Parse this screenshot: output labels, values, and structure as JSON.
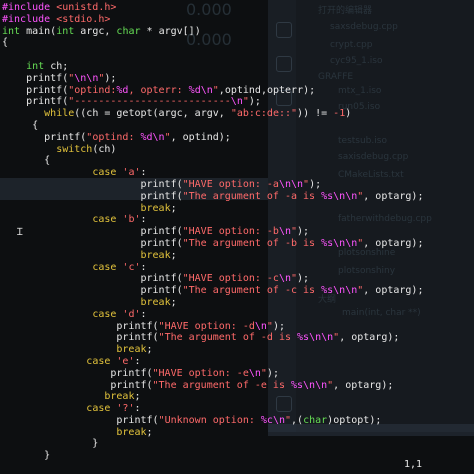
{
  "status": {
    "position": "1,1"
  },
  "lines": [
    [
      [
        "pp",
        "#include "
      ],
      [
        "inc",
        "<unistd.h>"
      ]
    ],
    [
      [
        "pp",
        "#include "
      ],
      [
        "inc",
        "<stdio.h>"
      ]
    ],
    [
      [
        "ty",
        "int "
      ],
      [
        "fn",
        "main("
      ],
      [
        "ty",
        "int "
      ],
      [
        "id",
        "argc, "
      ],
      [
        "ty",
        "char "
      ],
      [
        "id",
        "* argv[])"
      ]
    ],
    [
      [
        "id",
        "{"
      ]
    ],
    [
      [
        "id",
        ""
      ]
    ],
    [
      [
        "id",
        "    "
      ],
      [
        "ty",
        "int "
      ],
      [
        "id",
        "ch;"
      ]
    ],
    [
      [
        "id",
        "    printf("
      ],
      [
        "str",
        "\""
      ],
      [
        "esc",
        "\\n\\n"
      ],
      [
        "str",
        "\""
      ],
      [
        "id",
        ");"
      ]
    ],
    [
      [
        "id",
        "    printf("
      ],
      [
        "str",
        "\"optind:"
      ],
      [
        "esc",
        "%d"
      ],
      [
        "str",
        ", opterr: "
      ],
      [
        "esc",
        "%d\\n"
      ],
      [
        "str",
        "\""
      ],
      [
        "id",
        ",optind,opterr);"
      ]
    ],
    [
      [
        "id",
        "    printf("
      ],
      [
        "str",
        "\"--------------------------"
      ],
      [
        "esc",
        "\\n"
      ],
      [
        "str",
        "\""
      ],
      [
        "id",
        ");"
      ]
    ],
    [
      [
        "id",
        "       "
      ],
      [
        "kw",
        "while"
      ],
      [
        "id",
        "((ch = getopt(argc, argv, "
      ],
      [
        "str",
        "\"ab:c:de::\""
      ],
      [
        "id",
        ")) != "
      ],
      [
        "str",
        "-1"
      ],
      [
        "id",
        ")"
      ]
    ],
    [
      [
        "id",
        "     {"
      ]
    ],
    [
      [
        "id",
        "       printf("
      ],
      [
        "str",
        "\"optind: "
      ],
      [
        "esc",
        "%d\\n"
      ],
      [
        "str",
        "\""
      ],
      [
        "id",
        ", optind);"
      ]
    ],
    [
      [
        "id",
        "         "
      ],
      [
        "kw",
        "switch"
      ],
      [
        "id",
        "(ch)"
      ]
    ],
    [
      [
        "id",
        "       {"
      ]
    ],
    [
      [
        "id",
        "               "
      ],
      [
        "kw",
        "case "
      ],
      [
        "str",
        "'a'"
      ],
      [
        "id",
        ":"
      ]
    ],
    [
      [
        "id",
        "                       printf("
      ],
      [
        "str",
        "\"HAVE option: -a"
      ],
      [
        "esc",
        "\\n\\n"
      ],
      [
        "str",
        "\""
      ],
      [
        "id",
        ");"
      ]
    ],
    [
      [
        "id",
        "                       printf("
      ],
      [
        "str",
        "\"The argument of -a is "
      ],
      [
        "esc",
        "%s\\n\\n"
      ],
      [
        "str",
        "\""
      ],
      [
        "id",
        ", optarg);"
      ]
    ],
    [
      [
        "id",
        "                       "
      ],
      [
        "kw",
        "break"
      ],
      [
        "id",
        ";"
      ]
    ],
    [
      [
        "id",
        "               "
      ],
      [
        "kw",
        "case "
      ],
      [
        "str",
        "'b'"
      ],
      [
        "id",
        ":"
      ]
    ],
    [
      [
        "id",
        "                       printf("
      ],
      [
        "str",
        "\"HAVE option: -b"
      ],
      [
        "esc",
        "\\n"
      ],
      [
        "str",
        "\""
      ],
      [
        "id",
        ");"
      ]
    ],
    [
      [
        "id",
        "                       printf("
      ],
      [
        "str",
        "\"The argument of -b is "
      ],
      [
        "esc",
        "%s\\n\\n"
      ],
      [
        "str",
        "\""
      ],
      [
        "id",
        ", optarg);"
      ]
    ],
    [
      [
        "id",
        "                       "
      ],
      [
        "kw",
        "break"
      ],
      [
        "id",
        ";"
      ]
    ],
    [
      [
        "id",
        "               "
      ],
      [
        "kw",
        "case "
      ],
      [
        "str",
        "'c'"
      ],
      [
        "id",
        ":"
      ]
    ],
    [
      [
        "id",
        "                       printf("
      ],
      [
        "str",
        "\"HAVE option: -c"
      ],
      [
        "esc",
        "\\n"
      ],
      [
        "str",
        "\""
      ],
      [
        "id",
        ");"
      ]
    ],
    [
      [
        "id",
        "                       printf("
      ],
      [
        "str",
        "\"The argument of -c is "
      ],
      [
        "esc",
        "%s\\n\\n"
      ],
      [
        "str",
        "\""
      ],
      [
        "id",
        ", optarg);"
      ]
    ],
    [
      [
        "id",
        "                       "
      ],
      [
        "kw",
        "break"
      ],
      [
        "id",
        ";"
      ]
    ],
    [
      [
        "id",
        "               "
      ],
      [
        "kw",
        "case "
      ],
      [
        "str",
        "'d'"
      ],
      [
        "id",
        ":"
      ]
    ],
    [
      [
        "id",
        "                   printf("
      ],
      [
        "str",
        "\"HAVE option: -d"
      ],
      [
        "esc",
        "\\n"
      ],
      [
        "str",
        "\""
      ],
      [
        "id",
        ");"
      ]
    ],
    [
      [
        "id",
        "                   printf("
      ],
      [
        "str",
        "\"The argument of -d is "
      ],
      [
        "esc",
        "%s\\n\\n"
      ],
      [
        "str",
        "\""
      ],
      [
        "id",
        ", optarg);"
      ]
    ],
    [
      [
        "id",
        "                   "
      ],
      [
        "kw",
        "break"
      ],
      [
        "id",
        ";"
      ]
    ],
    [
      [
        "id",
        "              "
      ],
      [
        "kw",
        "case "
      ],
      [
        "str",
        "'e'"
      ],
      [
        "id",
        ":"
      ]
    ],
    [
      [
        "id",
        "                  printf("
      ],
      [
        "str",
        "\"HAVE option: -e"
      ],
      [
        "esc",
        "\\n"
      ],
      [
        "str",
        "\""
      ],
      [
        "id",
        ");"
      ]
    ],
    [
      [
        "id",
        "                  printf("
      ],
      [
        "str",
        "\"The argument of -e is "
      ],
      [
        "esc",
        "%s\\n\\n"
      ],
      [
        "str",
        "\""
      ],
      [
        "id",
        ", optarg);"
      ]
    ],
    [
      [
        "id",
        "                 "
      ],
      [
        "kw",
        "break"
      ],
      [
        "id",
        ";"
      ]
    ],
    [
      [
        "id",
        "              "
      ],
      [
        "kw",
        "case "
      ],
      [
        "str",
        "'?'"
      ],
      [
        "id",
        ":"
      ]
    ],
    [
      [
        "id",
        "                   printf("
      ],
      [
        "str",
        "\"Unknown option: "
      ],
      [
        "esc",
        "%c\\n"
      ],
      [
        "str",
        "\""
      ],
      [
        "id",
        ",("
      ],
      [
        "ty",
        "char"
      ],
      [
        "id",
        ")optopt);"
      ]
    ],
    [
      [
        "id",
        "                   "
      ],
      [
        "kw",
        "break"
      ],
      [
        "id",
        ";"
      ]
    ],
    [
      [
        "id",
        "               }"
      ]
    ],
    [
      [
        "id",
        "       }"
      ]
    ]
  ],
  "ghost_labels": [
    "打开的编辑器",
    "saxsdebug.cpp",
    "crypt.cpp",
    "cyc95_1.iso",
    "GRAFFE",
    "mtx_1.iso",
    "run05.iso",
    "testsub.iso",
    "saxisdebug.cpp",
    "CMakeLists.txt",
    "fatherwithdebug.cpp",
    "plotsonshine",
    "plotsonshiny",
    "大纲",
    "main(int, char **)",
    "0.000",
    "0.000"
  ]
}
